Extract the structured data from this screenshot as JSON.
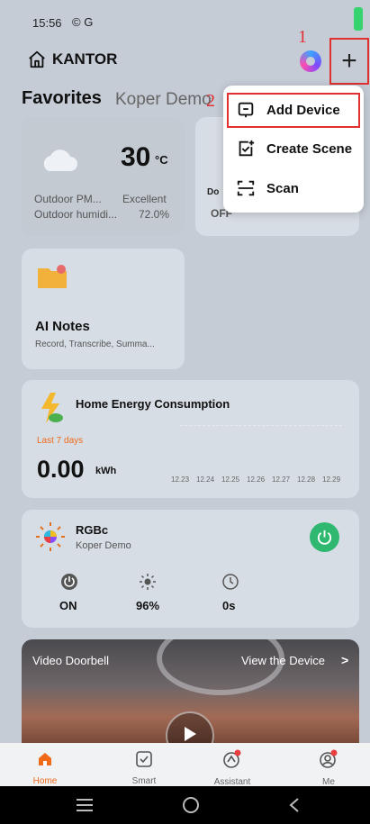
{
  "status": {
    "time": "15:56",
    "icons": "© G"
  },
  "header": {
    "title": "KANTOR",
    "plus": "+"
  },
  "annotations": {
    "a1": "1",
    "a2": "2"
  },
  "tabs": [
    {
      "label": "Favorites"
    },
    {
      "label": "Koper Demo"
    }
  ],
  "menu": {
    "items": [
      {
        "label": "Add Device"
      },
      {
        "label": "Create Scene"
      },
      {
        "label": "Scan"
      }
    ]
  },
  "weather": {
    "temp": "30",
    "unit": "°C",
    "row1_label": "Outdoor PM...",
    "row1_value": "Excellent",
    "row2_label": "Outdoor humidi...",
    "row2_value": "72.0%"
  },
  "door": {
    "label": "Do",
    "status": "OFF"
  },
  "notes": {
    "title": "AI Notes",
    "desc": "Record, Transcribe, Summa..."
  },
  "energy": {
    "title": "Home Energy Consumption",
    "period": "Last 7 days",
    "value": "0.00",
    "unit": "kWh",
    "dates": [
      "12.23",
      "12.24",
      "12.25",
      "12.26",
      "12.27",
      "12.28",
      "12.29"
    ]
  },
  "rgb": {
    "name": "RGBc",
    "room": "Koper Demo",
    "stats": [
      {
        "value": "ON"
      },
      {
        "value": "96%"
      },
      {
        "value": "0s"
      }
    ]
  },
  "video": {
    "title": "Video Doorbell",
    "action": "View the Device",
    "chevron": ">"
  },
  "nav": [
    {
      "label": "Home"
    },
    {
      "label": "Smart"
    },
    {
      "label": "Assistant"
    },
    {
      "label": "Me"
    }
  ],
  "colors": {
    "accent": "#f06a1a",
    "annotation": "#e03030",
    "power": "#2fb86f"
  }
}
